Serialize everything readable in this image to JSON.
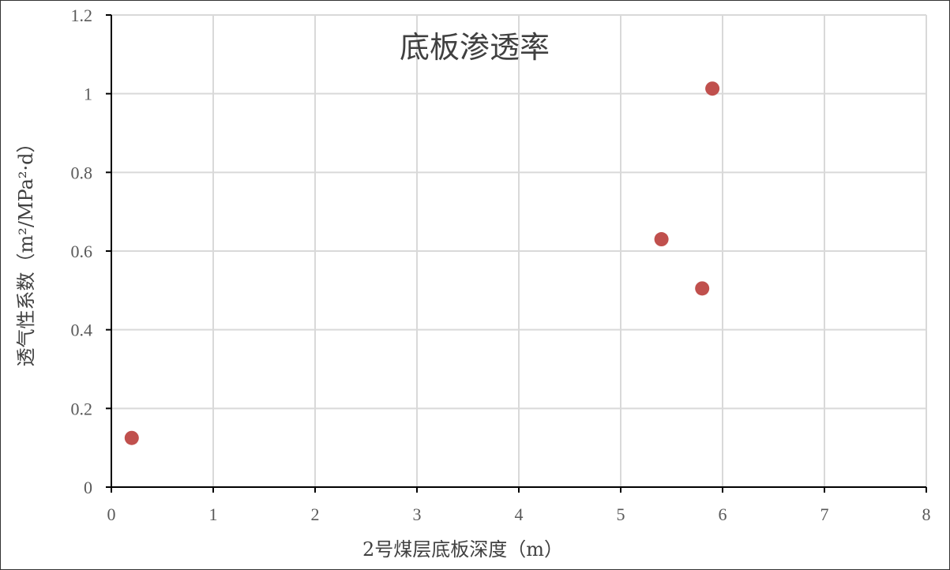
{
  "chart_data": {
    "type": "scatter",
    "title": "底板渗透率",
    "xlabel": "2号煤层底板深度（m）",
    "ylabel": "透气性系数（m²/MPa²·d）",
    "xlim": [
      0,
      8
    ],
    "ylim": [
      0,
      1.2
    ],
    "x_ticks": [
      "0",
      "1",
      "2",
      "3",
      "4",
      "5",
      "6",
      "7",
      "8"
    ],
    "y_ticks": [
      "0",
      "0.2",
      "0.4",
      "0.6",
      "0.8",
      "1",
      "1.2"
    ],
    "grid": true,
    "marker_color": "#C0504D",
    "series": [
      {
        "points": [
          {
            "x": 0.2,
            "y": 0.125
          },
          {
            "x": 5.4,
            "y": 0.63
          },
          {
            "x": 5.8,
            "y": 0.505
          },
          {
            "x": 5.9,
            "y": 1.013
          }
        ]
      }
    ]
  }
}
